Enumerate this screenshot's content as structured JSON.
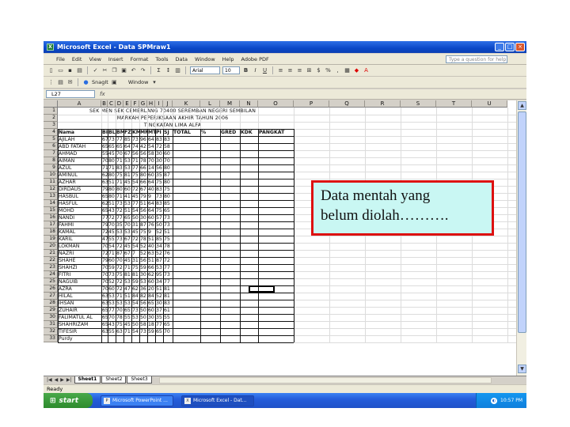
{
  "window": {
    "title": "Microsoft Excel - Data SPMraw1"
  },
  "menu": [
    "File",
    "Edit",
    "View",
    "Insert",
    "Format",
    "Tools",
    "Data",
    "Window",
    "Help",
    "Adobe PDF"
  ],
  "help_placeholder": "Type a question for help",
  "toolbar": {
    "snagit_label": "SnagIt",
    "window_label": "Window",
    "font": "Arial",
    "font_size": "10"
  },
  "formula_bar": {
    "name_box": "L27",
    "fx": "fx"
  },
  "columns": [
    "A",
    "B",
    "C",
    "D",
    "E",
    "F",
    "G",
    "H",
    "I",
    "J",
    "K",
    "L",
    "M",
    "N",
    "O",
    "P",
    "Q",
    "R",
    "S",
    "T",
    "U"
  ],
  "rows": [
    "1",
    "2",
    "3",
    "4",
    "5",
    "6",
    "7",
    "8",
    "9",
    "10",
    "11",
    "12",
    "13",
    "14",
    "15",
    "16",
    "17",
    "18",
    "19",
    "20",
    "21",
    "22",
    "23",
    "24",
    "25",
    "26",
    "27",
    "28",
    "29",
    "30",
    "31",
    "32",
    "33"
  ],
  "sheet": {
    "title_lines": [
      "SEK MEN SEK CEMERLANG 70400 SEREMBAN NEGERI SEMBILAN",
      "MARKAH PEPERIKSAAN AKHIR TAHUN 2006",
      "TINGKATAN LIMA ALFA"
    ],
    "headers": [
      "Nama",
      "BI",
      "BL",
      "BM",
      "FZ",
      "KM",
      "MM",
      "MT",
      "PI",
      "SJ",
      "TOTAL",
      "%",
      "GRED",
      "KDK",
      "PANGKAT"
    ],
    "students": [
      {
        "name": "AJILAH",
        "marks": [
          "67",
          "73",
          "77",
          "85",
          "73",
          "96",
          "64",
          "83",
          "83"
        ]
      },
      {
        "name": "ABD FATAH",
        "marks": [
          "65",
          "65",
          "65",
          "64",
          "74",
          "42",
          "54",
          "72",
          "58"
        ]
      },
      {
        "name": "AHMAD",
        "marks": [
          "55",
          "45",
          "70",
          "67",
          "56",
          "56",
          "58",
          "30",
          "60"
        ]
      },
      {
        "name": "AIMAN",
        "marks": [
          "70",
          "80",
          "71",
          "53",
          "71",
          "78",
          "70",
          "30",
          "70"
        ]
      },
      {
        "name": "AZUL",
        "marks": [
          "71",
          "71",
          "83",
          "53",
          "77",
          "66",
          "14",
          "56",
          "80"
        ]
      },
      {
        "name": "AMINUL",
        "marks": [
          "62",
          "80",
          "75",
          "81",
          "75",
          "80",
          "60",
          "35",
          "87"
        ]
      },
      {
        "name": "AZHAR",
        "marks": [
          "63",
          "51",
          "71",
          "45",
          "54",
          "66",
          "64",
          "75",
          "80"
        ]
      },
      {
        "name": "DIRDAUS",
        "marks": [
          "79",
          "80",
          "80",
          "60",
          "72",
          "67",
          "40",
          "83",
          "75"
        ]
      },
      {
        "name": "HASBUL",
        "marks": [
          "65",
          "80",
          "71",
          "41",
          "45",
          "79",
          "9",
          "73",
          "80"
        ]
      },
      {
        "name": "HASFUL",
        "marks": [
          "62",
          "51",
          "73",
          "53",
          "77",
          "51",
          "64",
          "83",
          "85"
        ]
      },
      {
        "name": "MOHD",
        "marks": [
          "65",
          "43",
          "72",
          "51",
          "54",
          "56",
          "64",
          "75",
          "65"
        ]
      },
      {
        "name": "NANDI",
        "marks": [
          "77",
          "72",
          "77",
          "65",
          "50",
          "30",
          "60",
          "57",
          "73"
        ]
      },
      {
        "name": "FAHMI",
        "marks": [
          "79",
          "70",
          "35",
          "70",
          "31",
          "87",
          "76",
          "50",
          "73"
        ]
      },
      {
        "name": "KAMAL",
        "marks": [
          "72",
          "45",
          "53",
          "53",
          "45",
          "75",
          "9",
          "52",
          "51"
        ]
      },
      {
        "name": "KARIL",
        "marks": [
          "47",
          "55",
          "73",
          "67",
          "72",
          "78",
          "51",
          "85",
          "75"
        ]
      },
      {
        "name": "LOKMAN",
        "marks": [
          "70",
          "54",
          "72",
          "45",
          "54",
          "52",
          "40",
          "34",
          "78"
        ]
      },
      {
        "name": "NAZRI",
        "marks": [
          "72",
          "71",
          "87",
          "67",
          "7",
          "52",
          "63",
          "52",
          "76"
        ]
      },
      {
        "name": "SHAHE",
        "marks": [
          "79",
          "60",
          "70",
          "45",
          "31",
          "56",
          "51",
          "87",
          "72"
        ]
      },
      {
        "name": "SHAHZI",
        "marks": [
          "70",
          "59",
          "72",
          "71",
          "75",
          "59",
          "66",
          "53",
          "77"
        ]
      },
      {
        "name": "FITRI",
        "marks": [
          "70",
          "73",
          "75",
          "81",
          "81",
          "30",
          "62",
          "95",
          "73"
        ]
      },
      {
        "name": "NAGUIB",
        "marks": [
          "70",
          "52",
          "72",
          "53",
          "59",
          "53",
          "60",
          "34",
          "77"
        ]
      },
      {
        "name": "AZRA",
        "marks": [
          "70",
          "60",
          "72",
          "47",
          "62",
          "36",
          "20",
          "51",
          "81"
        ]
      },
      {
        "name": "HILAL",
        "marks": [
          "63",
          "53",
          "71",
          "51",
          "84",
          "82",
          "84",
          "52",
          "81"
        ]
      },
      {
        "name": "IHSAN",
        "marks": [
          "63",
          "53",
          "53",
          "53",
          "54",
          "56",
          "65",
          "30",
          "83"
        ]
      },
      {
        "name": "ZUHAIR",
        "marks": [
          "65",
          "77",
          "70",
          "65",
          "73",
          "50",
          "60",
          "37",
          "61"
        ]
      },
      {
        "name": "FALIMATUL AL",
        "marks": [
          "65",
          "70",
          "78",
          "55",
          "53",
          "50",
          "30",
          "35",
          "55"
        ]
      },
      {
        "name": "SHAHRIZAM",
        "marks": [
          "65",
          "43",
          "75",
          "45",
          "50",
          "58",
          "18",
          "77",
          "65"
        ]
      },
      {
        "name": "TIFESIR",
        "marks": [
          "63",
          "55",
          "63",
          "71",
          "54",
          "73",
          "59",
          "65",
          "70"
        ]
      },
      {
        "name": "Purdy",
        "marks": [
          "",
          "",
          "",
          "",
          "",
          "",
          "",
          "",
          ""
        ]
      }
    ]
  },
  "sheet_tabs": [
    "Sheet1",
    "Sheet2",
    "Sheet3"
  ],
  "status": "Ready",
  "taskbar": {
    "start": "start",
    "items": [
      "Microsoft PowerPoint ...",
      "Microsoft Excel - Dat..."
    ],
    "clock": "10:57 PM"
  },
  "callout": {
    "line1": "Data mentah yang",
    "line2": "belum diolah………."
  }
}
